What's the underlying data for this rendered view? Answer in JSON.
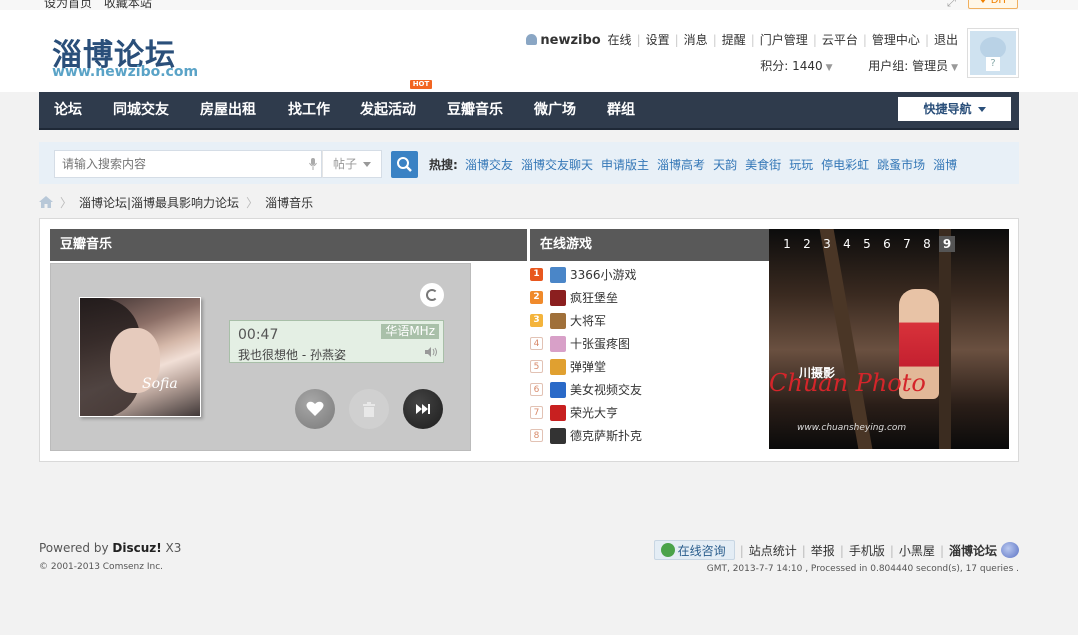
{
  "topbar": {
    "links": [
      "设为首页",
      "收藏本站"
    ],
    "diy_label": "♦ DIY"
  },
  "header": {
    "logo_title": "淄博论坛",
    "logo_url": "www.newzibo.com",
    "username": "newzibo",
    "status": "在线",
    "user_links": [
      "设置",
      "消息",
      "提醒",
      "门户管理",
      "云平台",
      "管理中心",
      "退出"
    ],
    "points_label": "积分: 1440",
    "group_label": "用户组: 管理员"
  },
  "nav": {
    "items": [
      "论坛",
      "同城交友",
      "房屋出租",
      "找工作",
      "发起活动",
      "豆瓣音乐",
      "微广场",
      "群组"
    ],
    "hot_badge": "HOT",
    "quick_nav": "快捷导航"
  },
  "search": {
    "placeholder": "请输入搜索内容",
    "type": "帖子",
    "hot_label": "热搜:",
    "hot_terms": [
      "淄博交友",
      "淄博交友聊天",
      "申请版主",
      "淄博高考",
      "天韵",
      "美食街",
      "玩玩",
      "停电彩虹",
      "跳蚤市场",
      "淄博"
    ]
  },
  "breadcrumb": [
    "淄博论坛|淄博最具影响力论坛",
    "淄博音乐"
  ],
  "music": {
    "title": "豆瓣音乐",
    "time": "00:47",
    "channel": "华语MHz",
    "song": "我也很想他 - 孙燕姿",
    "album_sig": "Sofia"
  },
  "games": {
    "title": "在线游戏",
    "items": [
      {
        "rank": "1",
        "name": "3366小游戏",
        "color": "#4a86c8"
      },
      {
        "rank": "2",
        "name": "疯狂堡垒",
        "color": "#8b1f1f"
      },
      {
        "rank": "3",
        "name": "大将军",
        "color": "#a0703a"
      },
      {
        "rank": "4",
        "name": "十张蛋疼图",
        "color": "#d8a0c8"
      },
      {
        "rank": "5",
        "name": "弹弹堂",
        "color": "#e0a030"
      },
      {
        "rank": "6",
        "name": "美女视频交友",
        "color": "#2a6ac8"
      },
      {
        "rank": "7",
        "name": "荣光大亨",
        "color": "#c82020"
      },
      {
        "rank": "8",
        "name": "德克萨斯扑克",
        "color": "#333333"
      }
    ]
  },
  "slideshow": {
    "pages": [
      "1",
      "2",
      "3",
      "4",
      "5",
      "6",
      "7",
      "8",
      "9"
    ],
    "active_page": "9",
    "brand": "Chuan Photo",
    "brand_cn": "川摄影",
    "url": "www.chuansheying.com"
  },
  "footer": {
    "powered_prefix": "Powered by ",
    "powered_name": "Discuz!",
    "powered_ver": " X3",
    "copyright": "© 2001-2013 Comsenz Inc.",
    "consult": "在线咨询",
    "links": [
      "站点统计",
      "举报",
      "手机版",
      "小黑屋"
    ],
    "site_name": "淄博论坛",
    "gmt": "GMT, 2013-7-7 14:10 , Processed in 0.804440 second(s), 17 queries ."
  }
}
